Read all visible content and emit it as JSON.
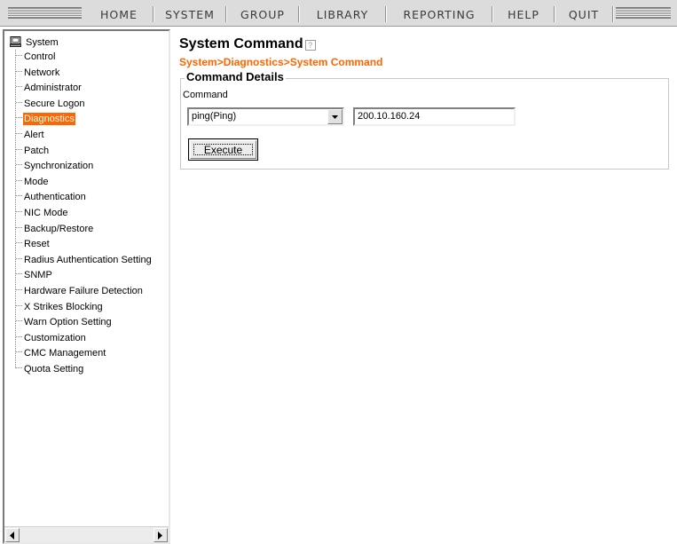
{
  "menu": {
    "items": [
      "HOME",
      "SYSTEM",
      "GROUP",
      "LIBRARY",
      "REPORTING",
      "HELP",
      "QUIT"
    ]
  },
  "tree": {
    "root": "System",
    "root_icon": "computer-icon",
    "items": [
      "Control",
      "Network",
      "Administrator",
      "Secure Logon",
      "Diagnostics",
      "Alert",
      "Patch",
      "Synchronization",
      "Mode",
      "Authentication",
      "NIC Mode",
      "Backup/Restore",
      "Reset",
      "Radius Authentication Setting",
      "SNMP",
      "Hardware Failure Detection",
      "X Strikes Blocking",
      "Warn Option Setting",
      "Customization",
      "CMC Management",
      "Quota Setting"
    ],
    "selected": "Diagnostics"
  },
  "page": {
    "title": "System Command",
    "help_icon": "help-icon",
    "breadcrumb": "System>Diagnostics>System Command"
  },
  "form": {
    "legend": "Command Details",
    "command_label": "Command",
    "command_value": "ping(Ping)",
    "target_value": "200.10.160.24",
    "execute_label": "Execute"
  },
  "colors": {
    "accent": "#ff6600",
    "menubar": "#dcdcdc"
  }
}
